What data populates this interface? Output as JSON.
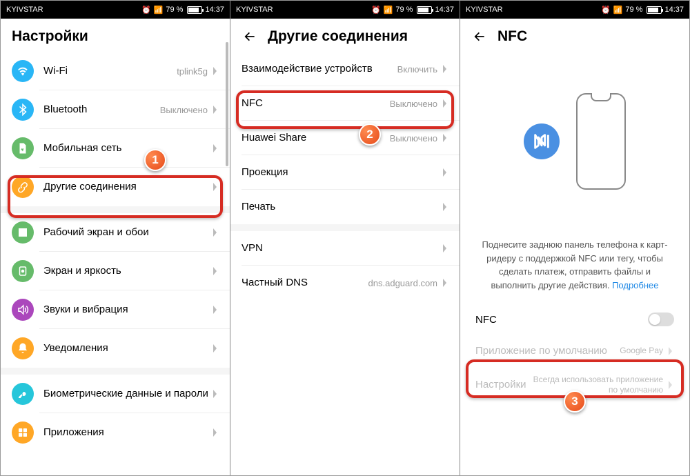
{
  "status": {
    "carrier": "KYIVSTAR",
    "battery": "79 %",
    "time": "14:37"
  },
  "screen1": {
    "title": "Настройки",
    "items": [
      {
        "label": "Wi-Fi",
        "value": "tplink5g",
        "color": "#29b6f6",
        "icon": "wifi"
      },
      {
        "label": "Bluetooth",
        "value": "Выключено",
        "color": "#29b6f6",
        "icon": "bt"
      },
      {
        "label": "Мобильная сеть",
        "value": "",
        "color": "#66bb6a",
        "icon": "sim"
      },
      {
        "label": "Другие соединения",
        "value": "",
        "color": "#ffa726",
        "icon": "link"
      },
      {
        "label": "Рабочий экран и обои",
        "value": "",
        "color": "#66bb6a",
        "icon": "picture"
      },
      {
        "label": "Экран и яркость",
        "value": "",
        "color": "#66bb6a",
        "icon": "brightness"
      },
      {
        "label": "Звуки и вибрация",
        "value": "",
        "color": "#ab47bc",
        "icon": "sound"
      },
      {
        "label": "Уведомления",
        "value": "",
        "color": "#ffa726",
        "icon": "bell"
      },
      {
        "label": "Биометрические данные и пароли",
        "value": "",
        "color": "#26c6da",
        "icon": "key"
      },
      {
        "label": "Приложения",
        "value": "",
        "color": "#ffa726",
        "icon": "apps"
      }
    ]
  },
  "screen2": {
    "title": "Другие соединения",
    "items": [
      {
        "label": "Взаимодействие устройств",
        "value": "Включить"
      },
      {
        "label": "NFC",
        "value": "Выключено"
      },
      {
        "label": "Huawei Share",
        "value": "Выключено"
      },
      {
        "label": "Проекция",
        "value": ""
      },
      {
        "label": "Печать",
        "value": ""
      },
      {
        "label": "VPN",
        "value": ""
      },
      {
        "label": "Частный DNS",
        "value": "dns.adguard.com"
      }
    ]
  },
  "screen3": {
    "title": "NFC",
    "desc": "Поднесите заднюю панель телефона к карт-ридеру с поддержкой NFC или тегу, чтобы сделать платеж, отправить файлы и выполнить другие действия. ",
    "more": "Подробнее",
    "toggle_label": "NFC",
    "default_app_label": "Приложение по умолчанию",
    "default_app_value": "Google Pay",
    "settings_label": "Настройки",
    "settings_value": "Всегда использовать приложение по умолчанию"
  },
  "markers": {
    "m1": "1",
    "m2": "2",
    "m3": "3"
  }
}
